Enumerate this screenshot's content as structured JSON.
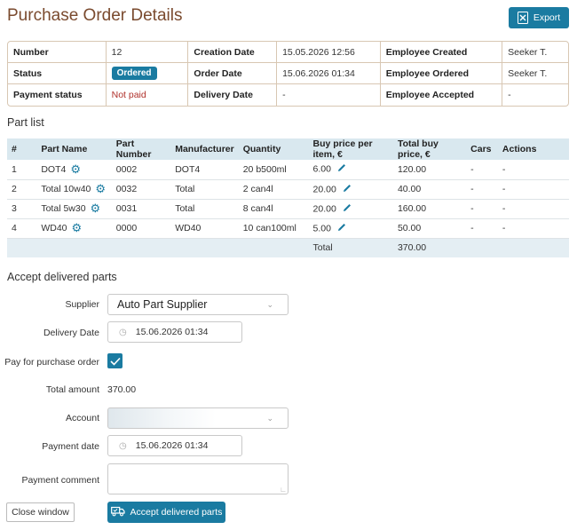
{
  "page": {
    "title": "Purchase Order Details",
    "export_label": "Export"
  },
  "info": {
    "rows": [
      [
        {
          "label": "Number",
          "value": "12"
        },
        {
          "label": "Creation Date",
          "value": "15.05.2026 12:56"
        },
        {
          "label": "Employee Created",
          "value": "Seeker T."
        }
      ],
      [
        {
          "label": "Status",
          "value": "Ordered"
        },
        {
          "label": "Order Date",
          "value": "15.06.2026 01:34"
        },
        {
          "label": "Employee Ordered",
          "value": "Seeker T."
        }
      ],
      [
        {
          "label": "Payment status",
          "value": "Not paid"
        },
        {
          "label": "Delivery Date",
          "value": "-"
        },
        {
          "label": "Employee Accepted",
          "value": "-"
        }
      ]
    ]
  },
  "parts": {
    "section_title": "Part list",
    "headers": [
      "#",
      "Part Name",
      "Part Number",
      "Manufacturer",
      "Quantity",
      "Buy price per item, €",
      "Total buy price, €",
      "Cars",
      "Actions"
    ],
    "rows": [
      {
        "num": "1",
        "name": "DOT4",
        "part_number": "0002",
        "manufacturer": "DOT4",
        "quantity": "20 b500ml",
        "price": "6.00",
        "total": "120.00",
        "cars": "-",
        "actions": "-"
      },
      {
        "num": "2",
        "name": "Total 10w40",
        "part_number": "0032",
        "manufacturer": "Total",
        "quantity": "2 can4l",
        "price": "20.00",
        "total": "40.00",
        "cars": "-",
        "actions": "-"
      },
      {
        "num": "3",
        "name": "Total 5w30",
        "part_number": "0031",
        "manufacturer": "Total",
        "quantity": "8 can4l",
        "price": "20.00",
        "total": "160.00",
        "cars": "-",
        "actions": "-"
      },
      {
        "num": "4",
        "name": "WD40",
        "part_number": "0000",
        "manufacturer": "WD40",
        "quantity": "10 can100ml",
        "price": "5.00",
        "total": "50.00",
        "cars": "-",
        "actions": "-"
      }
    ],
    "total_label": "Total",
    "total_value": "370.00"
  },
  "accept": {
    "section_title": "Accept delivered parts",
    "supplier_label": "Supplier",
    "supplier_value": "Auto Part Supplier",
    "delivery_date_label": "Delivery Date",
    "delivery_date_value": "15.06.2026 01:34",
    "pay_label": "Pay for purchase order",
    "pay_checked": true,
    "total_amount_label": "Total amount",
    "total_amount_value": "370.00",
    "account_label": "Account",
    "account_value": "",
    "payment_date_label": "Payment date",
    "payment_date_value": "15.06.2026 01:34",
    "payment_comment_label": "Payment comment",
    "payment_comment_value": ""
  },
  "actions": {
    "close_label": "Close window",
    "accept_label": "Accept delivered parts"
  },
  "colors": {
    "accent": "#1a7ba1",
    "title": "#7a4a2e",
    "not_paid": "#b0302a",
    "table_header": "#d9e8ef"
  }
}
